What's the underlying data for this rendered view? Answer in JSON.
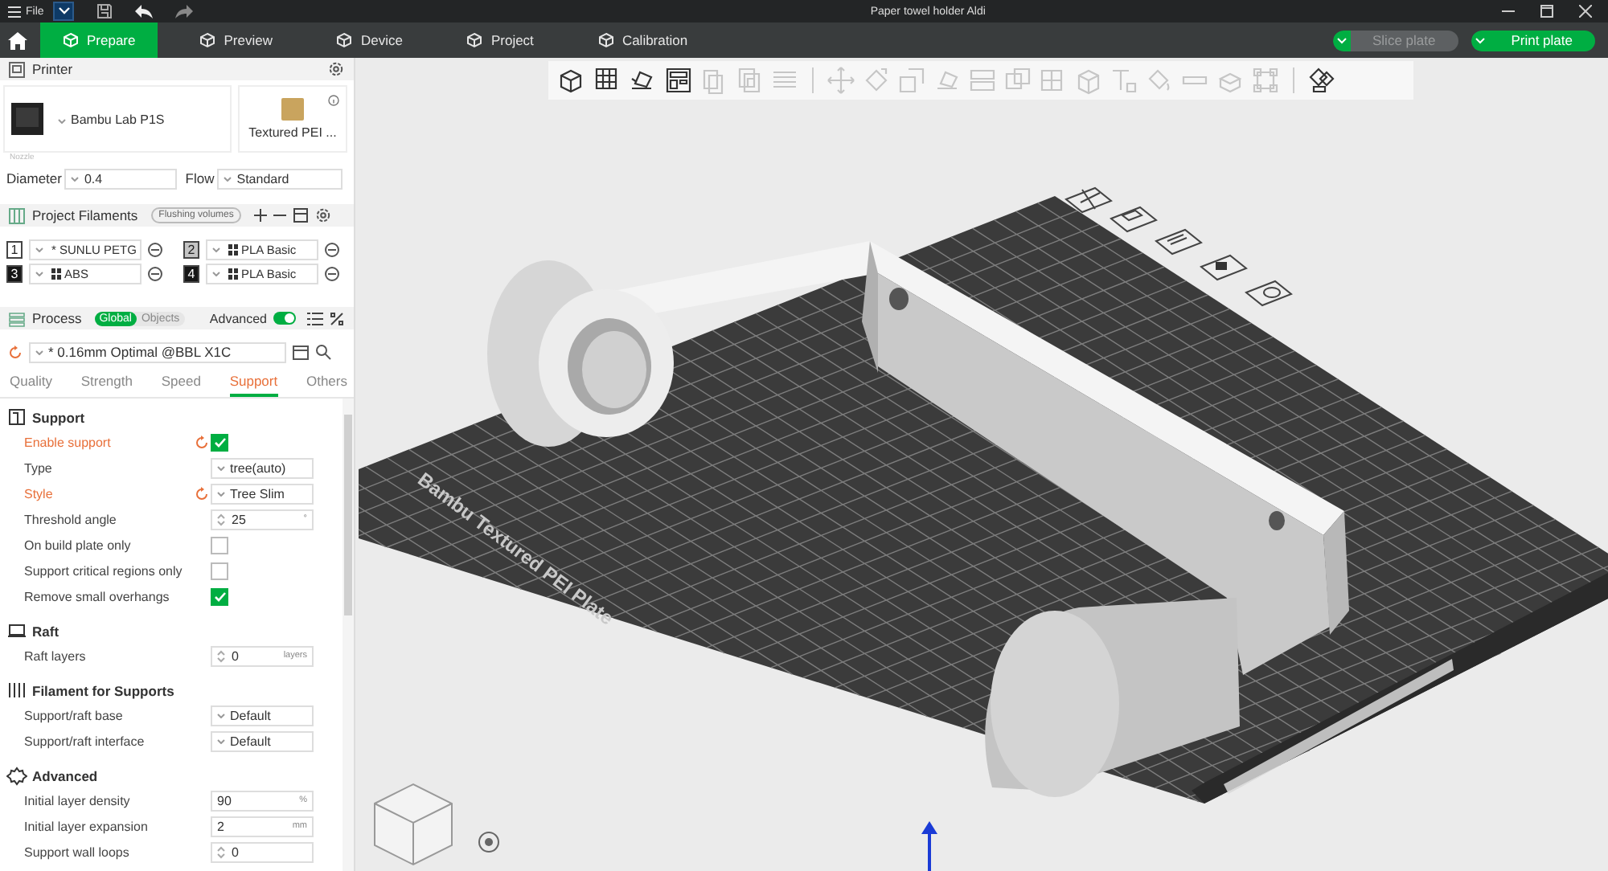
{
  "titlebar": {
    "menu": "File",
    "title": "Paper towel holder Aldi"
  },
  "tabs": [
    {
      "label": "Prepare",
      "selected": true
    },
    {
      "label": "Preview",
      "selected": false
    },
    {
      "label": "Device",
      "selected": false
    },
    {
      "label": "Project",
      "selected": false
    },
    {
      "label": "Calibration",
      "selected": false
    }
  ],
  "actions": [
    {
      "label": "Slice plate",
      "disabled": true
    },
    {
      "label": "Print plate",
      "disabled": false
    }
  ],
  "printer": {
    "title": "Printer",
    "name": "Bambu Lab P1S",
    "plate": "Textured PEI ...",
    "nozzle_label": "Nozzle",
    "diameter_label": "Diameter",
    "diameter": "0.4",
    "flow_label": "Flow",
    "flow": "Standard"
  },
  "filaments": {
    "title": "Project Filaments",
    "flushing": "Flushing volumes",
    "items": [
      {
        "index": "1",
        "name": "* SUNLU PETG",
        "color": "#ffffff",
        "swatch": false
      },
      {
        "index": "2",
        "name": "PLA Basic",
        "color": "#c4c4c4",
        "swatch": true
      },
      {
        "index": "3",
        "name": "ABS",
        "color": "#161616",
        "swatch": true
      },
      {
        "index": "4",
        "name": "PLA Basic",
        "color": "#161616",
        "swatch": true
      }
    ]
  },
  "process": {
    "title": "Process",
    "scopes": [
      {
        "label": "Global",
        "selected": true
      },
      {
        "label": "Objects",
        "selected": false
      }
    ],
    "advanced_label": "Advanced",
    "advanced": true,
    "preset": "* 0.16mm Optimal @BBL X1C",
    "tabs": [
      {
        "label": "Quality",
        "selected": false
      },
      {
        "label": "Strength",
        "selected": false
      },
      {
        "label": "Speed",
        "selected": false
      },
      {
        "label": "Support",
        "selected": true
      },
      {
        "label": "Others",
        "selected": false
      }
    ]
  },
  "sections": [
    {
      "title": "Support",
      "rows": [
        {
          "label": "Enable support",
          "modified": true,
          "kind": "checkbox",
          "checked": true
        },
        {
          "label": "Type",
          "modified": false,
          "kind": "select",
          "value": "tree(auto)"
        },
        {
          "label": "Style",
          "modified": true,
          "kind": "select",
          "value": "Tree Slim"
        },
        {
          "label": "Threshold angle",
          "modified": false,
          "kind": "spin",
          "value": "25",
          "unit": "°"
        },
        {
          "label": "On build plate only",
          "modified": false,
          "kind": "checkbox",
          "checked": false
        },
        {
          "label": "Support critical regions only",
          "modified": false,
          "kind": "checkbox",
          "checked": false
        },
        {
          "label": "Remove small overhangs",
          "modified": false,
          "kind": "checkbox",
          "checked": true
        }
      ]
    },
    {
      "title": "Raft",
      "rows": [
        {
          "label": "Raft layers",
          "modified": false,
          "kind": "spin",
          "value": "0",
          "unit": "layers"
        }
      ]
    },
    {
      "title": "Filament for Supports",
      "rows": [
        {
          "label": "Support/raft base",
          "modified": false,
          "kind": "select",
          "value": "Default"
        },
        {
          "label": "Support/raft interface",
          "modified": false,
          "kind": "select",
          "value": "Default"
        }
      ]
    },
    {
      "title": "Advanced",
      "rows": [
        {
          "label": "Initial layer density",
          "modified": false,
          "kind": "input",
          "value": "90",
          "unit": "%"
        },
        {
          "label": "Initial layer expansion",
          "modified": false,
          "kind": "input",
          "value": "2",
          "unit": "mm"
        },
        {
          "label": "Support wall loops",
          "modified": false,
          "kind": "spin",
          "value": "0"
        }
      ]
    }
  ],
  "toolbar": [
    {
      "kind": "add",
      "disabled": false
    },
    {
      "kind": "grid",
      "disabled": false
    },
    {
      "kind": "arrange",
      "disabled": false
    },
    {
      "kind": "layout",
      "disabled": false
    },
    {
      "kind": "copy",
      "disabled": true
    },
    {
      "kind": "paste",
      "disabled": true
    },
    {
      "kind": "layers",
      "disabled": true
    },
    {
      "kind": "sep"
    },
    {
      "kind": "move",
      "disabled": true
    },
    {
      "kind": "rotate",
      "disabled": true
    },
    {
      "kind": "scale",
      "disabled": true
    },
    {
      "kind": "flat",
      "disabled": true
    },
    {
      "kind": "split",
      "disabled": true
    },
    {
      "kind": "boolean",
      "disabled": true
    },
    {
      "kind": "cut",
      "disabled": true
    },
    {
      "kind": "cube",
      "disabled": true
    },
    {
      "kind": "text",
      "disabled": true
    },
    {
      "kind": "paint",
      "disabled": true
    },
    {
      "kind": "measure",
      "disabled": true
    },
    {
      "kind": "seam",
      "disabled": true
    },
    {
      "kind": "frame",
      "disabled": true
    },
    {
      "kind": "sep"
    },
    {
      "kind": "assembly",
      "disabled": false
    }
  ],
  "plate": {
    "label": "Bambu Textured PEI Plate"
  }
}
